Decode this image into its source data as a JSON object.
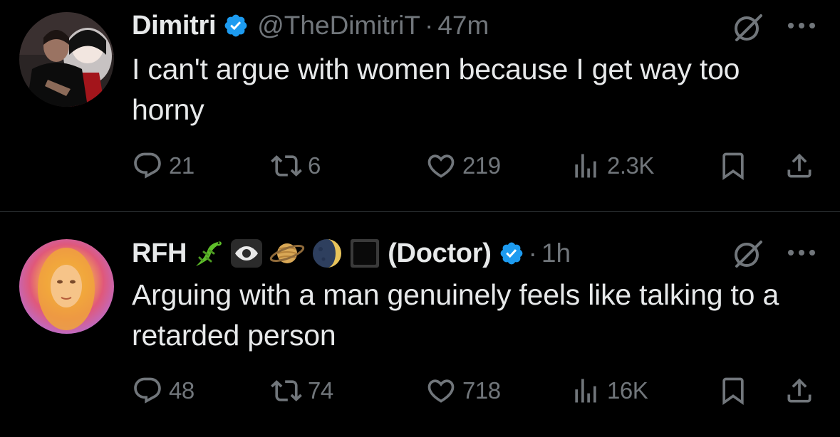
{
  "colors": {
    "background": "#000000",
    "text_primary": "#e7e9ea",
    "text_secondary": "#71767b",
    "verified": "#1d9bf0",
    "divider": "#2f3336"
  },
  "tweets": [
    {
      "name": "Dimitri",
      "verified": true,
      "handle": "@TheDimitriT",
      "separator": "·",
      "time": "47m",
      "text": "I can't argue with women because I get way too horny",
      "stats": {
        "replies": "21",
        "retweets": "6",
        "likes": "219",
        "views": "2.3K"
      }
    },
    {
      "name": "RFH",
      "name_emojis": [
        "lizard-emoji",
        "eye-emoji",
        "ringed-planet-emoji",
        "moon-emoji",
        "black-square-emoji"
      ],
      "name_suffix": "(Doctor)",
      "verified": true,
      "separator": "·",
      "time": "1h",
      "text": "Arguing with a man genuinely feels like talking to a retarded person",
      "stats": {
        "replies": "48",
        "retweets": "74",
        "likes": "718",
        "views": "16K"
      }
    }
  ]
}
